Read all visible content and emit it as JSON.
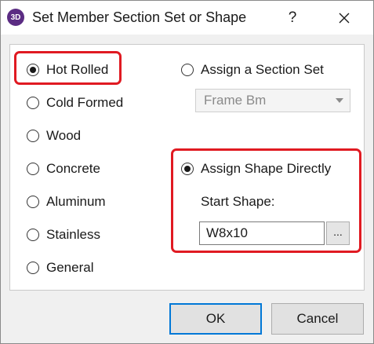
{
  "window": {
    "title": "Set Member Section Set or Shape",
    "app_icon_text": "3D",
    "help_label": "?",
    "close_icon": "close-icon"
  },
  "material_options": [
    {
      "label": "Hot Rolled",
      "checked": true
    },
    {
      "label": "Cold Formed",
      "checked": false
    },
    {
      "label": "Wood",
      "checked": false
    },
    {
      "label": "Concrete",
      "checked": false
    },
    {
      "label": "Aluminum",
      "checked": false
    },
    {
      "label": "Stainless",
      "checked": false
    },
    {
      "label": "General",
      "checked": false
    }
  ],
  "assign_section_set": {
    "label": "Assign a Section Set",
    "checked": false,
    "selected_value": "Frame Bm",
    "enabled": false
  },
  "assign_shape": {
    "label": "Assign Shape Directly",
    "checked": true,
    "start_shape_label": "Start Shape:",
    "start_shape_value": "W8x10",
    "browse_label": "..."
  },
  "buttons": {
    "ok": "OK",
    "cancel": "Cancel"
  },
  "colors": {
    "highlight_red": "#e01a22",
    "default_button_border": "#0078d7",
    "app_icon": "#5b2c83"
  }
}
